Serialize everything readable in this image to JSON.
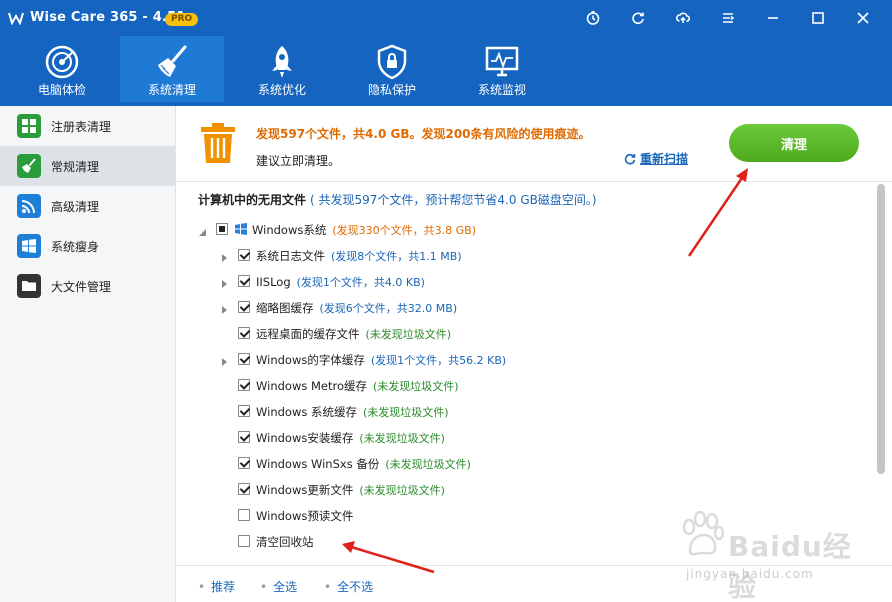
{
  "app": {
    "title": "Wise Care 365 - 4.51",
    "badge": "PRO"
  },
  "titlebar_icons": [
    "timer-icon",
    "refresh-icon",
    "cloud-upload-icon",
    "menu-icon",
    "minimize-icon",
    "maximize-icon",
    "close-icon"
  ],
  "nav": [
    {
      "label": "电脑体检",
      "icon": "radar-icon",
      "active": false
    },
    {
      "label": "系统清理",
      "icon": "broom-icon",
      "active": true
    },
    {
      "label": "系统优化",
      "icon": "rocket-icon",
      "active": false
    },
    {
      "label": "隐私保护",
      "icon": "shield-icon",
      "active": false
    },
    {
      "label": "系统监视",
      "icon": "monitor-icon",
      "active": false
    }
  ],
  "sidebar": [
    {
      "label": "注册表清理",
      "icon": "registry-icon",
      "color": "#2a9d3a",
      "active": false
    },
    {
      "label": "常规清理",
      "icon": "broom-icon",
      "color": "#2a9d3a",
      "active": true
    },
    {
      "label": "高级清理",
      "icon": "advanced-clean-icon",
      "color": "#1e7fd6",
      "active": false
    },
    {
      "label": "系统瘦身",
      "icon": "windows-icon",
      "color": "#1e7fd6",
      "active": false
    },
    {
      "label": "大文件管理",
      "icon": "folder-icon",
      "color": "#333333",
      "active": false
    }
  ],
  "summary": {
    "line1": "发现597个文件，共4.0 GB。发现200条有风险的使用痕迹。",
    "line2": "建议立即清理。",
    "rescan": "重新扫描",
    "clean_button": "清理"
  },
  "section": {
    "title": "计算机中的无用文件",
    "desc": "( 共发现597个文件，预计帮您节省4.0 GB磁盘空间。)"
  },
  "tree": [
    {
      "label": "Windows系统",
      "status": "(发现330个文件，共3.8 GB)",
      "status_color": "orange",
      "level": 0,
      "expander": "down",
      "check": "partial",
      "icon": true
    },
    {
      "label": "系统日志文件",
      "status": "(发现8个文件，共1.1 MB)",
      "status_color": "blue",
      "level": 1,
      "expander": "right",
      "check": "checked"
    },
    {
      "label": "IISLog",
      "status": "(发现1个文件，共4.0 KB)",
      "status_color": "blue",
      "level": 1,
      "expander": "right",
      "check": "checked"
    },
    {
      "label": "缩略图缓存",
      "status": "(发现6个文件，共32.0 MB)",
      "status_color": "blue",
      "level": 1,
      "expander": "right",
      "check": "checked"
    },
    {
      "label": "远程桌面的缓存文件",
      "status": "(未发现垃圾文件)",
      "status_color": "green",
      "level": 1,
      "expander": "none",
      "check": "checked"
    },
    {
      "label": "Windows的字体缓存",
      "status": "(发现1个文件，共56.2 KB)",
      "status_color": "blue",
      "level": 1,
      "expander": "right",
      "check": "checked"
    },
    {
      "label": "Windows Metro缓存",
      "status": "(未发现垃圾文件)",
      "status_color": "green",
      "level": 1,
      "expander": "none",
      "check": "checked"
    },
    {
      "label": "Windows 系统缓存",
      "status": "(未发现垃圾文件)",
      "status_color": "green",
      "level": 1,
      "expander": "none",
      "check": "checked"
    },
    {
      "label": "Windows安装缓存",
      "status": "(未发现垃圾文件)",
      "status_color": "green",
      "level": 1,
      "expander": "none",
      "check": "checked"
    },
    {
      "label": "Windows WinSxs 备份",
      "status": "(未发现垃圾文件)",
      "status_color": "green",
      "level": 1,
      "expander": "none",
      "check": "checked"
    },
    {
      "label": "Windows更新文件",
      "status": "(未发现垃圾文件)",
      "status_color": "green",
      "level": 1,
      "expander": "none",
      "check": "checked"
    },
    {
      "label": "Windows预读文件",
      "status": "",
      "status_color": "blue",
      "level": 1,
      "expander": "none",
      "check": "unchecked"
    },
    {
      "label": "清空回收站",
      "status": "",
      "status_color": "blue",
      "level": 1,
      "expander": "none",
      "check": "unchecked"
    }
  ],
  "footer": {
    "recommend": "推荐",
    "select_all": "全选",
    "select_none": "全不选"
  },
  "watermark": {
    "text": "Baidu经验",
    "sub": "jingyan.baidu.com"
  },
  "colors": {
    "brand": "#1565c0",
    "accent_green": "#5cb82c",
    "warning_orange": "#e06a00",
    "link_blue": "#1a66b8",
    "arrow_red": "#e0201a"
  }
}
